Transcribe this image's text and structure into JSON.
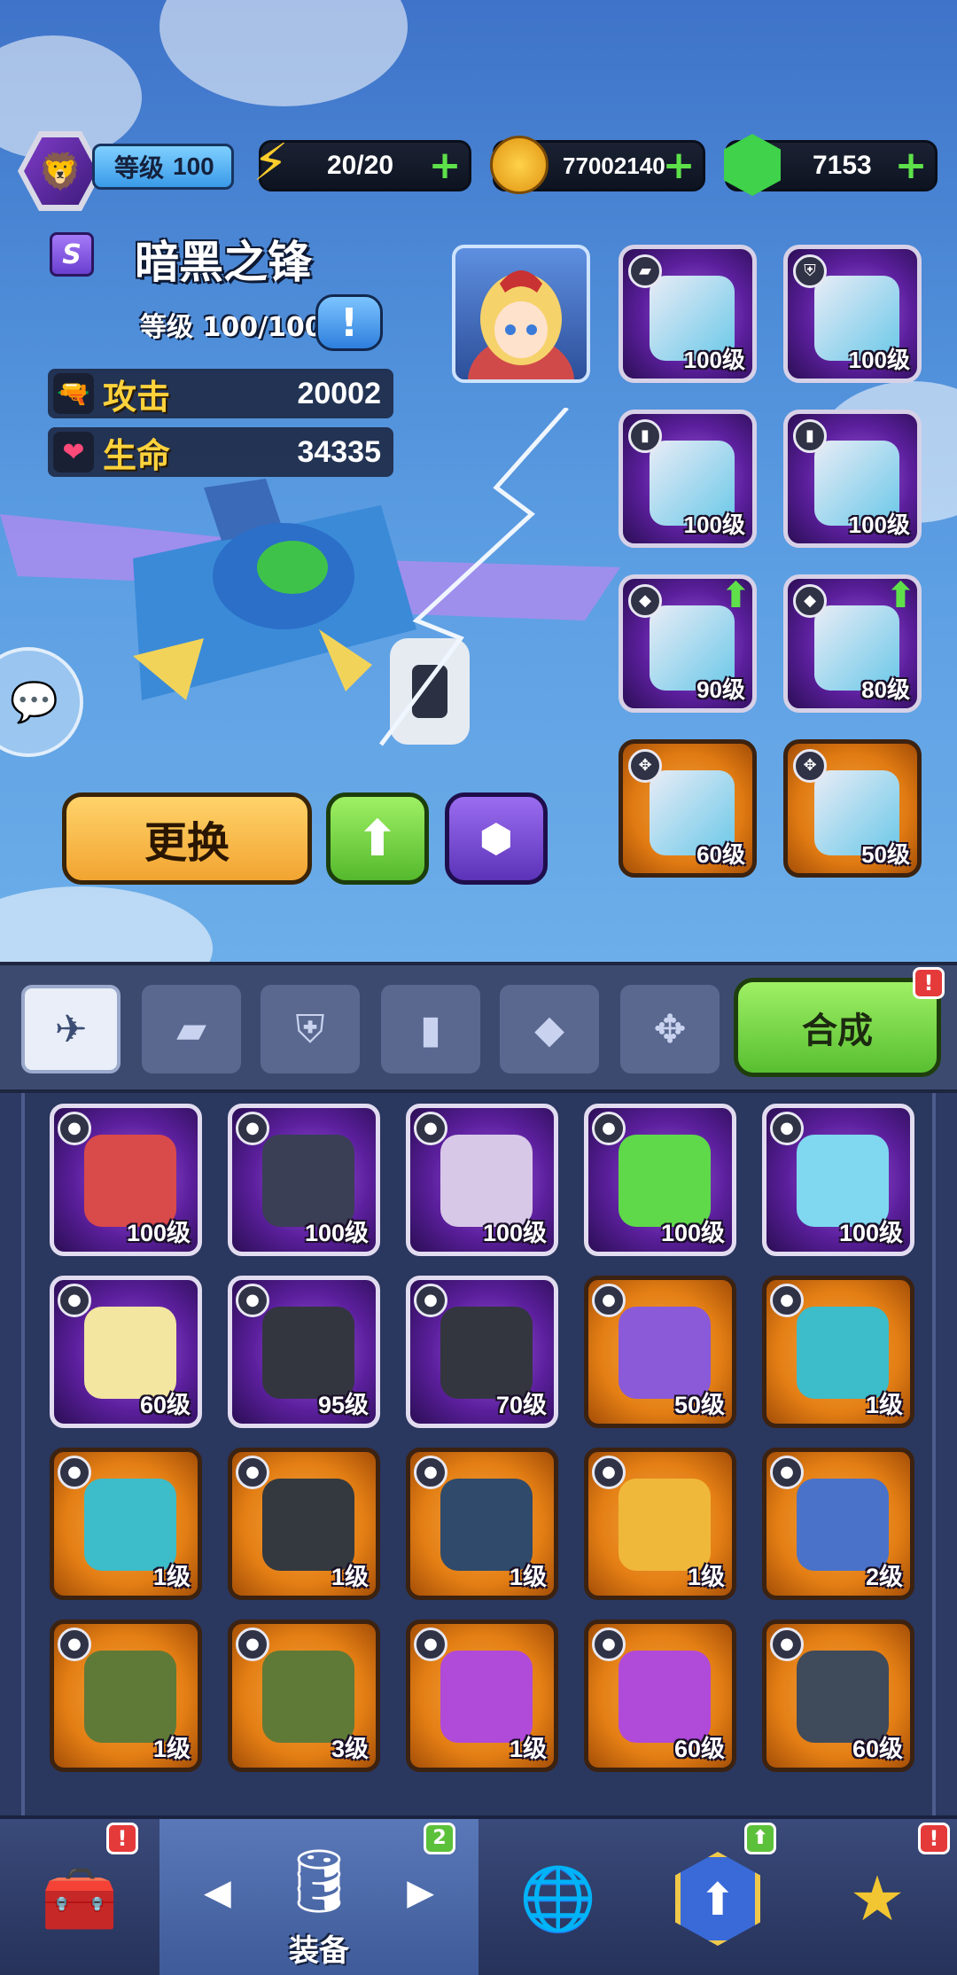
{
  "status_bar": {
    "level_label": "等级",
    "level_value": "100",
    "energy": "20/20",
    "gold": "77002140",
    "gems": "7153"
  },
  "plane": {
    "rank": "S",
    "name": "暗黑之锋",
    "level_text": "等级 100/100",
    "attack_label": "攻击",
    "attack_value": "20002",
    "hp_label": "生命",
    "hp_value": "34335"
  },
  "equipped_slots": [
    {
      "level": "100级",
      "color": "purple",
      "tag": "missile"
    },
    {
      "level": "100级",
      "color": "purple",
      "tag": "shield"
    },
    {
      "level": "100级",
      "color": "purple",
      "tag": "capsule"
    },
    {
      "level": "100级",
      "color": "purple",
      "tag": "capsule"
    },
    {
      "level": "90级",
      "color": "purple",
      "tag": "drone",
      "upgrade": true
    },
    {
      "level": "80级",
      "color": "purple",
      "tag": "drone",
      "upgrade": true
    },
    {
      "level": "60级",
      "color": "orange",
      "tag": "chip"
    },
    {
      "level": "50级",
      "color": "orange",
      "tag": "chip"
    }
  ],
  "actions": {
    "replace_label": "更换"
  },
  "tabs": {
    "merge_label": "合成",
    "merge_badge": "!"
  },
  "inventory": [
    {
      "level": "100级",
      "color": "purple",
      "art": "#d94a4a"
    },
    {
      "level": "100级",
      "color": "purple",
      "art": "#3a3f55"
    },
    {
      "level": "100级",
      "color": "purple",
      "art": "#d8c8e8"
    },
    {
      "level": "100级",
      "color": "purple",
      "art": "#5fd94a"
    },
    {
      "level": "100级",
      "color": "purple",
      "art": "#7fd8f0"
    },
    {
      "level": "60级",
      "color": "purple",
      "art": "#f2e6a0"
    },
    {
      "level": "95级",
      "color": "purple",
      "art": "#33363f"
    },
    {
      "level": "70级",
      "color": "purple",
      "art": "#33363f"
    },
    {
      "level": "50级",
      "color": "orange",
      "art": "#8a5ad8"
    },
    {
      "level": "1级",
      "color": "orange",
      "art": "#3dbcc9"
    },
    {
      "level": "1级",
      "color": "orange",
      "art": "#3dbcc9"
    },
    {
      "level": "1级",
      "color": "orange",
      "art": "#33393f"
    },
    {
      "level": "1级",
      "color": "orange",
      "art": "#2f4a6a"
    },
    {
      "level": "1级",
      "color": "orange",
      "art": "#f0b83a"
    },
    {
      "level": "2级",
      "color": "orange",
      "art": "#4a72c8"
    },
    {
      "level": "1级",
      "color": "orange",
      "art": "#5f7a36"
    },
    {
      "level": "3级",
      "color": "orange",
      "art": "#5f7a36"
    },
    {
      "level": "1级",
      "color": "orange",
      "art": "#b04ad8"
    },
    {
      "level": "60级",
      "color": "orange",
      "art": "#b04ad8"
    },
    {
      "level": "60级",
      "color": "orange",
      "art": "#3f4a5a"
    }
  ],
  "bottom_nav": {
    "equip_label": "装备",
    "equip_badge": "2",
    "chest_badge": "!",
    "rank_badge": "!"
  }
}
